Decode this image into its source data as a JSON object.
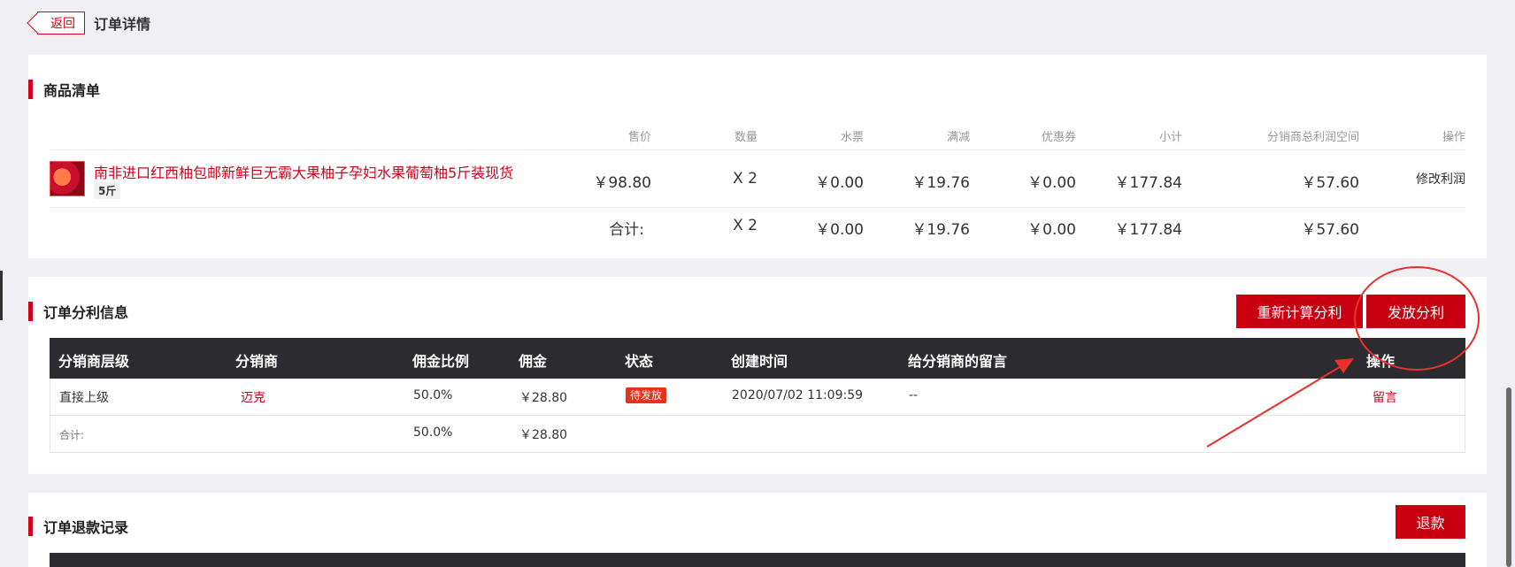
{
  "header": {
    "back_label": "返回",
    "title": "订单详情"
  },
  "goods": {
    "section_title": "商品清单",
    "columns": [
      "售价",
      "数量",
      "水票",
      "满减",
      "优惠券",
      "小计",
      "分销商总利润空间",
      "操作"
    ],
    "item": {
      "name": "南非进口红西柚包邮新鲜巨无霸大果柚子孕妇水果葡萄柚5斤装现货",
      "spec": "5斤",
      "price": "￥98.80",
      "qty": "X 2",
      "water_ticket": "￥0.00",
      "discount": "￥19.76",
      "coupon": "￥0.00",
      "subtotal": "￥177.84",
      "profit_space": "￥57.60",
      "action": "修改利润"
    },
    "total": {
      "label": "合计:",
      "qty": "X 2",
      "water_ticket": "￥0.00",
      "discount": "￥19.76",
      "coupon": "￥0.00",
      "subtotal": "￥177.84",
      "profit_space": "￥57.60"
    }
  },
  "commission": {
    "section_title": "订单分利信息",
    "recalc_button": "重新计算分利",
    "issue_button": "发放分利",
    "columns": [
      "分销商层级",
      "分销商",
      "佣金比例",
      "佣金",
      "状态",
      "创建时间",
      "给分销商的留言",
      "操作"
    ],
    "row": {
      "level": "直接上级",
      "distributor": "迈克",
      "ratio": "50.0%",
      "amount": "￥28.80",
      "status": "待发放",
      "created": "2020/07/02 11:09:59",
      "message": "--",
      "action": "留言"
    },
    "total": {
      "label": "合计:",
      "ratio": "50.0%",
      "amount": "￥28.80"
    }
  },
  "refund": {
    "section_title": "订单退款记录",
    "refund_button": "退款"
  },
  "colors": {
    "accent": "#c8000f",
    "header_dark": "#2c2b2f",
    "annotation": "#e8312a"
  }
}
